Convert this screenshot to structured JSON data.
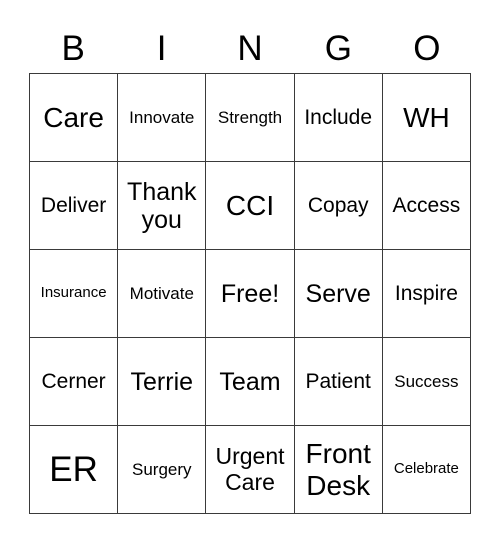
{
  "header": {
    "letters": [
      "B",
      "I",
      "N",
      "G",
      "O"
    ]
  },
  "grid": {
    "rows": [
      [
        "Care",
        "Innovate",
        "Strength",
        "Include",
        "WH"
      ],
      [
        "Deliver",
        "Thank you",
        "CCI",
        "Copay",
        "Access"
      ],
      [
        "Insurance",
        "Motivate",
        "Free!",
        "Serve",
        "Inspire"
      ],
      [
        "Cerner",
        "Terrie",
        "Team",
        "Patient",
        "Success"
      ],
      [
        "ER",
        "Surgery",
        "Urgent Care",
        "Front Desk",
        "Celebrate"
      ]
    ]
  }
}
